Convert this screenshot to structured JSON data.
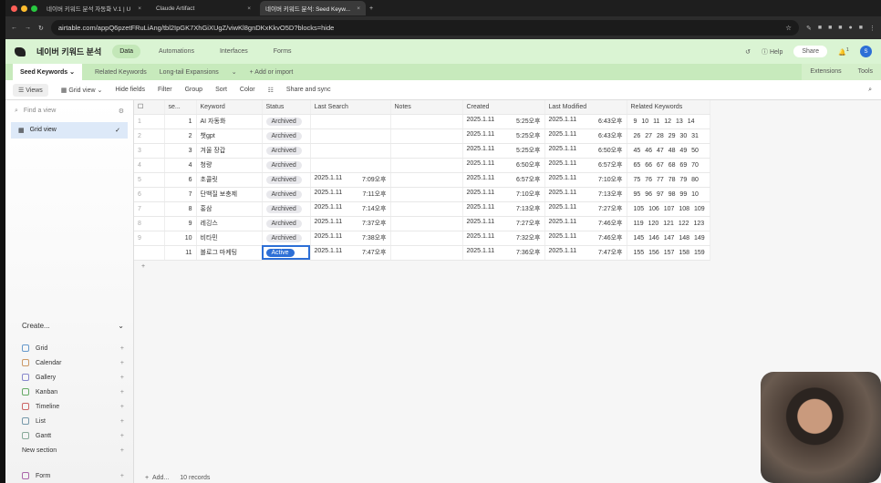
{
  "browser": {
    "tabs": [
      "네이버 키워드 분석 자동화 V.1 | U",
      "Claude Artifact",
      "네이버 키워드 분석: Seed Keyw..."
    ],
    "url": "airtable.com/appQ6pzetFRuLiAng/tbl2IpGK7XhGiXUgZ/viwKl8gnDKxKkvO5D?blocks=hide"
  },
  "header": {
    "base_name": "네이버 키워드 분석",
    "nav": [
      "Data",
      "Automations",
      "Interfaces",
      "Forms"
    ],
    "help": "Help",
    "share": "Share",
    "avatar": "S",
    "notif_count": "1"
  },
  "table_tabs": {
    "items": [
      "Seed Keywords",
      "Related Keywords",
      "Long-tail Expansions"
    ],
    "add": "+ Add or import",
    "extensions": "Extensions",
    "tools": "Tools"
  },
  "toolbar": {
    "views": "Views",
    "grid_view": "Grid view",
    "hide_fields": "Hide fields",
    "filter": "Filter",
    "group": "Group",
    "sort": "Sort",
    "color": "Color",
    "share_sync": "Share and sync"
  },
  "sidebar": {
    "find_placeholder": "Find a view",
    "grid_view": "Grid view",
    "create": "Create...",
    "create_items": [
      "Grid",
      "Calendar",
      "Gallery",
      "Kanban",
      "Timeline",
      "List",
      "Gantt"
    ],
    "new_section": "New section",
    "form": "Form"
  },
  "columns": [
    "se...",
    "Keyword",
    "Status",
    "Last Search",
    "Notes",
    "Created",
    "Last Modified",
    "Related Keywords"
  ],
  "rows": [
    {
      "n": "1",
      "se": "1",
      "kw": "AI 자동화",
      "st": "Archived",
      "ls": [
        "",
        ""
      ],
      "cr": [
        "2025.1.11",
        "5:25오후"
      ],
      "lm": [
        "2025.1.11",
        "6:43오후"
      ],
      "rk": "9 10 11 12 13 14"
    },
    {
      "n": "2",
      "se": "2",
      "kw": "챗gpt",
      "st": "Archived",
      "ls": [
        "",
        ""
      ],
      "cr": [
        "2025.1.11",
        "5:25오후"
      ],
      "lm": [
        "2025.1.11",
        "6:43오후"
      ],
      "rk": "26 27 28 29 30 31"
    },
    {
      "n": "3",
      "se": "3",
      "kw": "겨울 장갑",
      "st": "Archived",
      "ls": [
        "",
        ""
      ],
      "cr": [
        "2025.1.11",
        "5:25오후"
      ],
      "lm": [
        "2025.1.11",
        "6:50오후"
      ],
      "rk": "45 46 47 48 49 50"
    },
    {
      "n": "4",
      "se": "4",
      "kw": "청량",
      "st": "Archived",
      "ls": [
        "",
        ""
      ],
      "cr": [
        "2025.1.11",
        "6:50오후"
      ],
      "lm": [
        "2025.1.11",
        "6:57오후"
      ],
      "rk": "65 66 67 68 69 70"
    },
    {
      "n": "5",
      "se": "6",
      "kw": "초콜릿",
      "st": "Archived",
      "ls": [
        "2025.1.11",
        "7:09오후"
      ],
      "cr": [
        "2025.1.11",
        "6:57오후"
      ],
      "lm": [
        "2025.1.11",
        "7:10오후"
      ],
      "rk": "75 76 77 78 79 80"
    },
    {
      "n": "6",
      "se": "7",
      "kw": "단백질 보충제",
      "st": "Archived",
      "ls": [
        "2025.1.11",
        "7:11오후"
      ],
      "cr": [
        "2025.1.11",
        "7:10오후"
      ],
      "lm": [
        "2025.1.11",
        "7:13오후"
      ],
      "rk": "95 96 97 98 99 10"
    },
    {
      "n": "7",
      "se": "8",
      "kw": "홍삼",
      "st": "Archived",
      "ls": [
        "2025.1.11",
        "7:14오후"
      ],
      "cr": [
        "2025.1.11",
        "7:13오후"
      ],
      "lm": [
        "2025.1.11",
        "7:27오후"
      ],
      "rk": "105 106 107 108 109"
    },
    {
      "n": "8",
      "se": "9",
      "kw": "레깅스",
      "st": "Archived",
      "ls": [
        "2025.1.11",
        "7:37오후"
      ],
      "cr": [
        "2025.1.11",
        "7:27오후"
      ],
      "lm": [
        "2025.1.11",
        "7:46오후"
      ],
      "rk": "119 120 121 122 123"
    },
    {
      "n": "9",
      "se": "10",
      "kw": "비타민",
      "st": "Archived",
      "ls": [
        "2025.1.11",
        "7:38오후"
      ],
      "cr": [
        "2025.1.11",
        "7:32오후"
      ],
      "lm": [
        "2025.1.11",
        "7:46오후"
      ],
      "rk": "145 146 147 148 149"
    },
    {
      "n": "",
      "se": "11",
      "kw": "블로그 마케팅",
      "st": "Active",
      "ls": [
        "2025.1.11",
        "7:47오후"
      ],
      "cr": [
        "2025.1.11",
        "7:36오후"
      ],
      "lm": [
        "2025.1.11",
        "7:47오후"
      ],
      "rk": "155 156 157 158 159"
    }
  ],
  "footer": {
    "add": "Add...",
    "records": "10 records"
  }
}
